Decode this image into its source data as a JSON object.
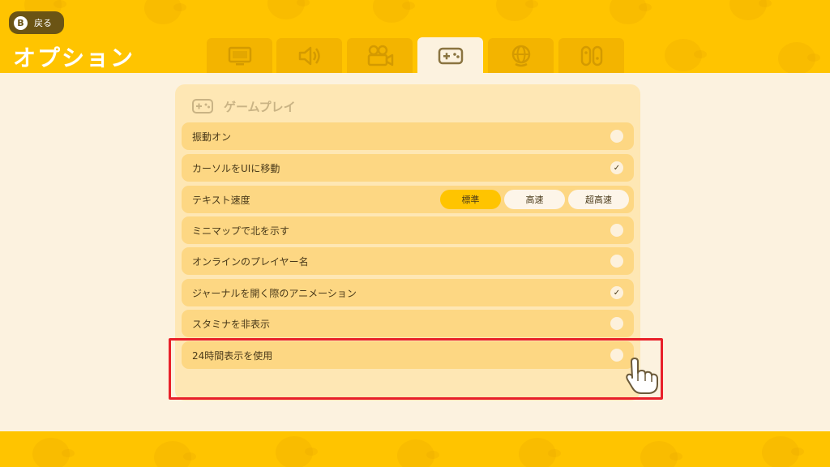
{
  "header": {
    "back_key": "B",
    "back_label": "戻る",
    "title": "オプション"
  },
  "tabs": [
    {
      "icon": "tv-icon",
      "active": false
    },
    {
      "icon": "speaker-icon",
      "active": false
    },
    {
      "icon": "video-camera-icon",
      "active": false
    },
    {
      "icon": "gamepad-icon",
      "active": true
    },
    {
      "icon": "globe-icon",
      "active": false
    },
    {
      "icon": "joycon-icon",
      "active": false
    }
  ],
  "section": {
    "icon": "gamepad-icon",
    "title": "ゲームプレイ"
  },
  "options": [
    {
      "label": "振動オン",
      "checked": false
    },
    {
      "label": "カーソルをUIに移動",
      "checked": true
    },
    {
      "label": "テキスト速度",
      "speeds": [
        "標準",
        "高速",
        "超高速"
      ],
      "selected": "標準"
    },
    {
      "label": "ミニマップで北を示す",
      "checked": false
    },
    {
      "label": "オンラインのプレイヤー名",
      "checked": false
    },
    {
      "label": "ジャーナルを開く際のアニメーション",
      "checked": true
    },
    {
      "label": "スタミナを非表示",
      "checked": false
    },
    {
      "label": "24時間表示を使用",
      "checked": false
    }
  ],
  "check_mark": "✓",
  "colors": {
    "brand_yellow": "#FFC400",
    "background": "#FCF2DF",
    "panel": "#FEE7B4",
    "row": "#FDD783",
    "text": "#4A3A1A",
    "highlight": "#E8202A"
  }
}
